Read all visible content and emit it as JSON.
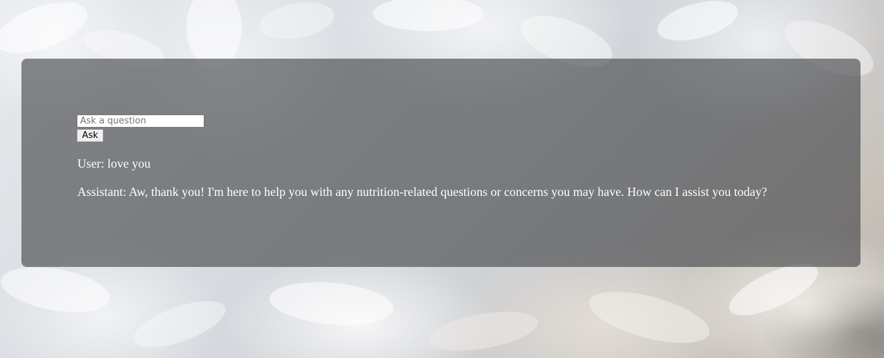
{
  "chat": {
    "input": {
      "placeholder": "Ask a question",
      "value": ""
    },
    "ask_button_label": "Ask",
    "messages": [
      {
        "role": "User",
        "text": "User: love you"
      },
      {
        "role": "Assistant",
        "text": "Assistant: Aw, thank you! I'm here to help you with any nutrition-related questions or concerns you may have. How can I assist you today?"
      }
    ]
  },
  "theme": {
    "panel_color": "#404246",
    "text_color": "#ffffff",
    "background_image": "white-chrysanthemum-flowers"
  }
}
